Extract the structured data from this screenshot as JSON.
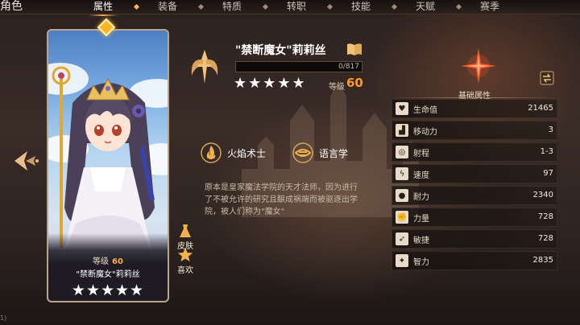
{
  "header": {
    "title": "角色",
    "tabs": [
      {
        "label": "属性",
        "active": true
      },
      {
        "label": "装备",
        "active": false
      },
      {
        "label": "特质",
        "active": false
      },
      {
        "label": "转职",
        "active": false
      },
      {
        "label": "技能",
        "active": false
      },
      {
        "label": "天赋",
        "active": false
      },
      {
        "label": "赛季",
        "active": false
      }
    ]
  },
  "card": {
    "level_label": "等级",
    "level_value": "60",
    "name": "\"禁断魔女\"莉莉丝",
    "stars": "★★★★★"
  },
  "side_buttons": {
    "skin_label": "皮肤",
    "like_label": "喜欢"
  },
  "hero": {
    "name": "\"禁断魔女\"莉莉丝",
    "xp_text": "0/817",
    "xp_progress": 0,
    "stars": "★★★★★",
    "level_label": "等级",
    "level_value": "60",
    "traits": [
      {
        "label": "火焰术士",
        "icon": "fire-mage-icon"
      },
      {
        "label": "语言学",
        "icon": "linguistics-icon"
      }
    ],
    "description": "原本是皇家魔法学院的天才法师，因为进行了不被允许的研究且酿成祸端而被驱逐出学院，被人们称为\"魔女\""
  },
  "attributes": {
    "title": "基础属性",
    "rows": [
      {
        "label": "生命值",
        "value": "21465",
        "icon": "heart-icon"
      },
      {
        "label": "移动力",
        "value": "3",
        "icon": "boot-icon"
      },
      {
        "label": "射程",
        "value": "1-3",
        "icon": "target-icon"
      },
      {
        "label": "速度",
        "value": "97",
        "icon": "lightning-icon"
      },
      {
        "label": "耐力",
        "value": "2340",
        "icon": "figure-icon"
      },
      {
        "label": "力量",
        "value": "728",
        "icon": "fist-icon"
      },
      {
        "label": "敏捷",
        "value": "728",
        "icon": "agility-icon"
      },
      {
        "label": "智力",
        "value": "2835",
        "icon": "intelligence-icon"
      }
    ]
  },
  "footer": {
    "corner_text": "1)"
  },
  "colors": {
    "accent": "#ff9a2a",
    "gem": "#ffb52a"
  }
}
